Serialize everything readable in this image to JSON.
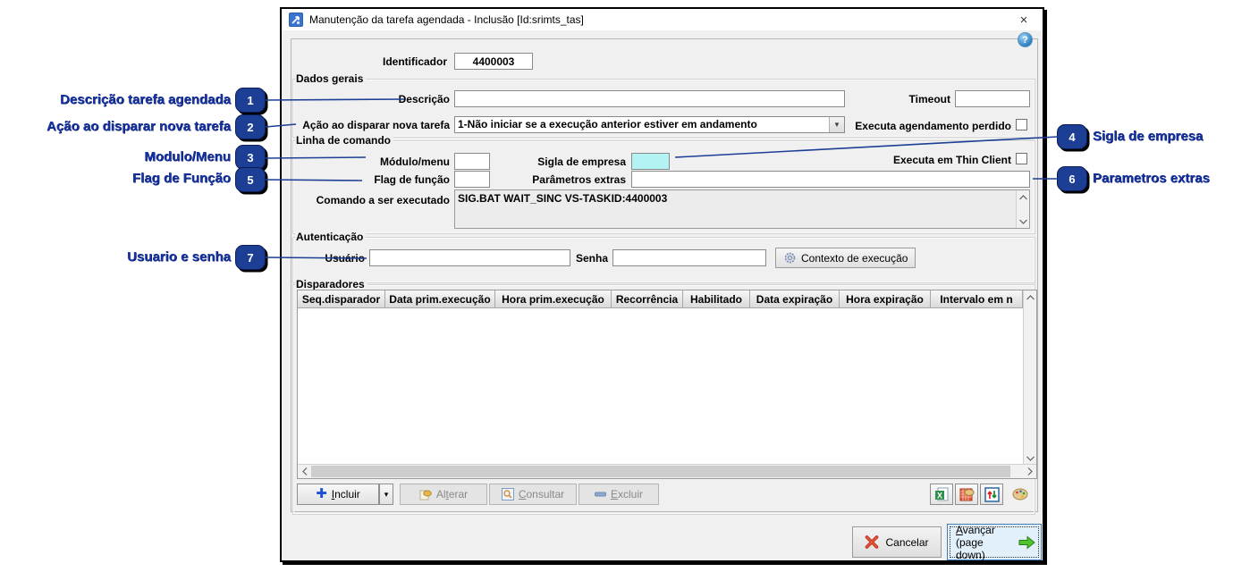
{
  "window": {
    "title": "Manutenção da tarefa agendada - Inclusão [Id:srimts_tas]",
    "close_label": "×",
    "help_label": "?"
  },
  "identificador": {
    "label": "Identificador",
    "value": "4400003"
  },
  "dados_gerais": {
    "legend": "Dados gerais",
    "descricao_label": "Descrição",
    "descricao_value": "",
    "timeout_label": "Timeout",
    "timeout_value": "",
    "acao_label": "Ação ao disparar nova tarefa",
    "acao_value": "1-Não iniciar se a execução anterior estiver em andamento",
    "combo_arrow": "▼",
    "agendamento_perdido_label": "Executa agendamento perdido"
  },
  "linha_comando": {
    "legend": "Linha de comando",
    "modulo_label": "Módulo/menu",
    "modulo_value": "",
    "sigla_label": "Sigla de empresa",
    "sigla_value": "",
    "thin_client_label": "Executa em Thin Client",
    "flag_label": "Flag de função",
    "flag_value": "",
    "parametros_label": "Parâmetros extras",
    "parametros_value": "",
    "comando_label": "Comando a ser executado",
    "comando_value": "SIG.BAT WAIT_SINC VS-TASKID:4400003"
  },
  "autenticacao": {
    "legend": "Autenticação",
    "usuario_label": "Usuário",
    "usuario_value": "",
    "senha_label": "Senha",
    "senha_value": "",
    "contexto_button": "Contexto de execução"
  },
  "disparadores": {
    "legend": "Disparadores",
    "columns": [
      "Seq.disparador",
      "Data prim.execução",
      "Hora prim.execução",
      "Recorrência",
      "Habilitado",
      "Data expiração",
      "Hora expiração",
      "Intervalo em n"
    ],
    "rows": []
  },
  "table_actions": {
    "incluir": {
      "pre": "",
      "key": "I",
      "post": "ncluir"
    },
    "dropdown_arrow": "▾",
    "alterar": {
      "pre": "Al",
      "key": "t",
      "post": "erar"
    },
    "consultar": {
      "pre": "",
      "key": "C",
      "post": "onsultar"
    },
    "excluir": {
      "pre": "",
      "key": "E",
      "post": "xcluir"
    }
  },
  "footer": {
    "cancelar_label": "Cancelar",
    "avancar": {
      "pre": "",
      "key": "A",
      "post": "vançar",
      "line2": "(page down)"
    }
  },
  "callouts": {
    "c1": {
      "num": "1",
      "label": "Descrição tarefa agendada"
    },
    "c2": {
      "num": "2",
      "label": "Ação ao disparar nova tarefa"
    },
    "c3": {
      "num": "3",
      "label": "Modulo/Menu"
    },
    "c4": {
      "num": "4",
      "label": "Sigla de empresa"
    },
    "c5": {
      "num": "5",
      "label": "Flag de Função"
    },
    "c6": {
      "num": "6",
      "label": "Parametros extras"
    },
    "c7": {
      "num": "7",
      "label": "Usuario e senha"
    }
  },
  "colors": {
    "callout_blue": "#1c3e94",
    "sigla_field_cyan": "#b3f3f3",
    "dialog_bg": "#f0f0f0",
    "avancar_bg": "#e2f0fb",
    "avancar_border": "#3f80b8",
    "cancel_x_red": "#cc2211",
    "avancar_arrow_green": "#3db526"
  }
}
